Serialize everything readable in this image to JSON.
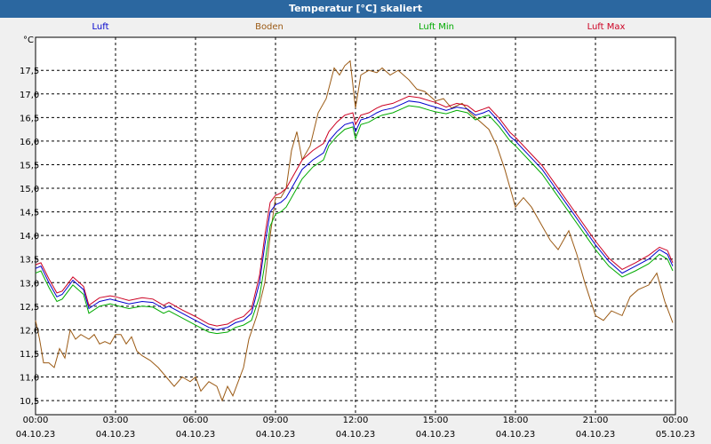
{
  "window": {
    "title": "Temperatur [°C] skaliert"
  },
  "colors": {
    "titlebar": "#2b67a0",
    "plot_background": "#ffffff",
    "page_background": "#f0f0f0",
    "grid": "#000000"
  },
  "chart_data": {
    "type": "line",
    "title": "Temperatur [°C] skaliert",
    "ylabel": "°C",
    "xlabel": "",
    "x_unit": "hours from 04.10.23 00:00",
    "xlim": [
      0,
      24
    ],
    "ylim": [
      10.2,
      18.2
    ],
    "grid": true,
    "grid_style": "dashed",
    "legend_placement": "top",
    "y_ticks": [
      "10,5",
      "11,0",
      "11,5",
      "12,0",
      "12,5",
      "13,0",
      "13,5",
      "14,0",
      "14,5",
      "15,0",
      "15,5",
      "16,0",
      "16,5",
      "17,0",
      "17,5"
    ],
    "y_tick_values": [
      10.5,
      11.0,
      11.5,
      12.0,
      12.5,
      13.0,
      13.5,
      14.0,
      14.5,
      15.0,
      15.5,
      16.0,
      16.5,
      17.0,
      17.5
    ],
    "x_ticks": [
      {
        "time": "00:00",
        "date": "04.10.23",
        "hour": 0
      },
      {
        "time": "03:00",
        "date": "04.10.23",
        "hour": 3
      },
      {
        "time": "06:00",
        "date": "04.10.23",
        "hour": 6
      },
      {
        "time": "09:00",
        "date": "04.10.23",
        "hour": 9
      },
      {
        "time": "12:00",
        "date": "04.10.23",
        "hour": 12
      },
      {
        "time": "15:00",
        "date": "04.10.23",
        "hour": 15
      },
      {
        "time": "18:00",
        "date": "04.10.23",
        "hour": 18
      },
      {
        "time": "21:00",
        "date": "04.10.23",
        "hour": 21
      },
      {
        "time": "00:00",
        "date": "05.10.23",
        "hour": 24
      }
    ],
    "series": [
      {
        "name": "Luft",
        "color": "#0000cc",
        "x": [
          0,
          0.2,
          0.5,
          0.8,
          1.0,
          1.4,
          1.8,
          2.0,
          2.4,
          2.8,
          3.0,
          3.5,
          4.0,
          4.4,
          4.8,
          5.0,
          5.5,
          6.0,
          6.5,
          6.8,
          7.2,
          7.5,
          7.8,
          8.1,
          8.4,
          8.6,
          8.8,
          9.0,
          9.2,
          9.4,
          9.7,
          10.0,
          10.4,
          10.8,
          11.0,
          11.3,
          11.6,
          11.9,
          12.0,
          12.2,
          12.5,
          12.8,
          13.0,
          13.4,
          13.8,
          14.0,
          14.4,
          14.8,
          15.0,
          15.4,
          15.8,
          16.2,
          16.5,
          16.8,
          17.0,
          17.4,
          17.8,
          18.0,
          18.5,
          19.0,
          19.5,
          20.0,
          20.5,
          21.0,
          21.5,
          22.0,
          22.5,
          23.0,
          23.4,
          23.7,
          23.9
        ],
        "values": [
          13.3,
          13.35,
          13.0,
          12.7,
          12.75,
          13.05,
          12.85,
          12.45,
          12.6,
          12.65,
          12.62,
          12.55,
          12.6,
          12.58,
          12.45,
          12.5,
          12.35,
          12.2,
          12.05,
          12.0,
          12.05,
          12.15,
          12.2,
          12.35,
          13.0,
          13.8,
          14.5,
          14.65,
          14.7,
          14.8,
          15.1,
          15.4,
          15.6,
          15.75,
          16.0,
          16.2,
          16.35,
          16.4,
          16.2,
          16.45,
          16.5,
          16.6,
          16.65,
          16.7,
          16.8,
          16.85,
          16.82,
          16.75,
          16.72,
          16.65,
          16.72,
          16.68,
          16.55,
          16.6,
          16.65,
          16.4,
          16.1,
          16.0,
          15.7,
          15.4,
          15.0,
          14.6,
          14.2,
          13.8,
          13.45,
          13.2,
          13.35,
          13.5,
          13.7,
          13.6,
          13.35
        ]
      },
      {
        "name": "Boden",
        "color": "#9b5a14",
        "x": [
          0,
          0.15,
          0.3,
          0.5,
          0.7,
          0.9,
          1.1,
          1.3,
          1.5,
          1.7,
          2.0,
          2.2,
          2.4,
          2.6,
          2.8,
          3.0,
          3.2,
          3.4,
          3.6,
          3.8,
          4.0,
          4.3,
          4.6,
          4.9,
          5.2,
          5.5,
          5.8,
          6.0,
          6.2,
          6.5,
          6.8,
          7.0,
          7.2,
          7.4,
          7.6,
          7.8,
          8.0,
          8.3,
          8.6,
          8.8,
          9.0,
          9.2,
          9.4,
          9.6,
          9.8,
          10.0,
          10.3,
          10.6,
          10.9,
          11.2,
          11.4,
          11.6,
          11.8,
          12.0,
          12.2,
          12.5,
          12.8,
          13.0,
          13.3,
          13.6,
          14.0,
          14.3,
          14.6,
          15.0,
          15.3,
          15.6,
          16.0,
          16.3,
          16.6,
          17.0,
          17.3,
          17.6,
          18.0,
          18.3,
          18.6,
          19.0,
          19.3,
          19.6,
          20.0,
          20.3,
          20.6,
          21.0,
          21.3,
          21.6,
          22.0,
          22.3,
          22.6,
          23.0,
          23.3,
          23.6,
          23.9
        ],
        "values": [
          12.2,
          11.8,
          11.3,
          11.3,
          11.2,
          11.6,
          11.4,
          12.0,
          11.8,
          11.9,
          11.8,
          11.9,
          11.7,
          11.75,
          11.7,
          11.9,
          11.9,
          11.7,
          11.85,
          11.55,
          11.45,
          11.35,
          11.2,
          11.0,
          10.8,
          11.0,
          10.9,
          11.0,
          10.7,
          10.9,
          10.8,
          10.5,
          10.8,
          10.6,
          10.9,
          11.2,
          11.8,
          12.3,
          13.0,
          14.0,
          14.8,
          14.8,
          15.0,
          15.8,
          16.2,
          15.6,
          15.9,
          16.6,
          16.9,
          17.55,
          17.4,
          17.6,
          17.7,
          16.7,
          17.4,
          17.5,
          17.45,
          17.55,
          17.4,
          17.5,
          17.3,
          17.1,
          17.05,
          16.85,
          16.9,
          16.7,
          16.8,
          16.6,
          16.45,
          16.25,
          15.9,
          15.4,
          14.6,
          14.8,
          14.6,
          14.2,
          13.9,
          13.7,
          14.1,
          13.6,
          13.0,
          12.3,
          12.2,
          12.4,
          12.3,
          12.7,
          12.85,
          12.95,
          13.2,
          12.6,
          12.15
        ]
      },
      {
        "name": "Luft Min",
        "color": "#00aa00",
        "x": [
          0,
          0.2,
          0.5,
          0.8,
          1.0,
          1.4,
          1.8,
          2.0,
          2.4,
          2.8,
          3.0,
          3.5,
          4.0,
          4.4,
          4.8,
          5.0,
          5.5,
          6.0,
          6.5,
          6.8,
          7.2,
          7.5,
          7.8,
          8.1,
          8.4,
          8.6,
          8.8,
          9.0,
          9.2,
          9.4,
          9.7,
          10.0,
          10.4,
          10.8,
          11.0,
          11.3,
          11.6,
          11.9,
          12.0,
          12.2,
          12.5,
          12.8,
          13.0,
          13.4,
          13.8,
          14.0,
          14.4,
          14.8,
          15.0,
          15.4,
          15.8,
          16.2,
          16.5,
          16.8,
          17.0,
          17.4,
          17.8,
          18.0,
          18.5,
          19.0,
          19.5,
          20.0,
          20.5,
          21.0,
          21.5,
          22.0,
          22.5,
          23.0,
          23.4,
          23.7,
          23.9
        ],
        "values": [
          13.2,
          13.25,
          12.9,
          12.6,
          12.65,
          12.95,
          12.75,
          12.35,
          12.5,
          12.55,
          12.52,
          12.45,
          12.5,
          12.48,
          12.35,
          12.4,
          12.25,
          12.1,
          11.95,
          11.92,
          11.95,
          12.05,
          12.1,
          12.2,
          12.7,
          13.4,
          14.2,
          14.45,
          14.5,
          14.6,
          14.9,
          15.2,
          15.45,
          15.6,
          15.9,
          16.1,
          16.25,
          16.3,
          16.05,
          16.35,
          16.4,
          16.5,
          16.55,
          16.6,
          16.7,
          16.75,
          16.72,
          16.65,
          16.62,
          16.58,
          16.65,
          16.6,
          16.45,
          16.52,
          16.55,
          16.3,
          16.0,
          15.9,
          15.6,
          15.3,
          14.9,
          14.5,
          14.1,
          13.7,
          13.35,
          13.12,
          13.25,
          13.4,
          13.6,
          13.5,
          13.25
        ]
      },
      {
        "name": "Luft Max",
        "color": "#cc0022",
        "x": [
          0,
          0.2,
          0.5,
          0.8,
          1.0,
          1.4,
          1.8,
          2.0,
          2.4,
          2.8,
          3.0,
          3.5,
          4.0,
          4.4,
          4.8,
          5.0,
          5.5,
          6.0,
          6.5,
          6.8,
          7.2,
          7.5,
          7.8,
          8.1,
          8.4,
          8.6,
          8.8,
          9.0,
          9.2,
          9.4,
          9.7,
          10.0,
          10.4,
          10.8,
          11.0,
          11.3,
          11.6,
          11.9,
          12.0,
          12.2,
          12.5,
          12.8,
          13.0,
          13.4,
          13.8,
          14.0,
          14.4,
          14.8,
          15.0,
          15.4,
          15.8,
          16.2,
          16.5,
          16.8,
          17.0,
          17.4,
          17.8,
          18.0,
          18.5,
          19.0,
          19.5,
          20.0,
          20.5,
          21.0,
          21.5,
          22.0,
          22.5,
          23.0,
          23.4,
          23.7,
          23.9
        ],
        "values": [
          13.38,
          13.42,
          13.08,
          12.78,
          12.82,
          13.12,
          12.92,
          12.52,
          12.68,
          12.72,
          12.7,
          12.62,
          12.68,
          12.65,
          12.52,
          12.58,
          12.42,
          12.28,
          12.12,
          12.08,
          12.12,
          12.22,
          12.28,
          12.45,
          13.15,
          14.0,
          14.7,
          14.85,
          14.9,
          15.0,
          15.3,
          15.6,
          15.8,
          15.95,
          16.2,
          16.4,
          16.55,
          16.6,
          16.35,
          16.55,
          16.6,
          16.7,
          16.75,
          16.8,
          16.9,
          16.95,
          16.92,
          16.85,
          16.82,
          16.72,
          16.8,
          16.75,
          16.62,
          16.68,
          16.72,
          16.48,
          16.18,
          16.08,
          15.78,
          15.48,
          15.08,
          14.68,
          14.28,
          13.88,
          13.52,
          13.28,
          13.42,
          13.58,
          13.75,
          13.68,
          13.42
        ]
      }
    ]
  }
}
